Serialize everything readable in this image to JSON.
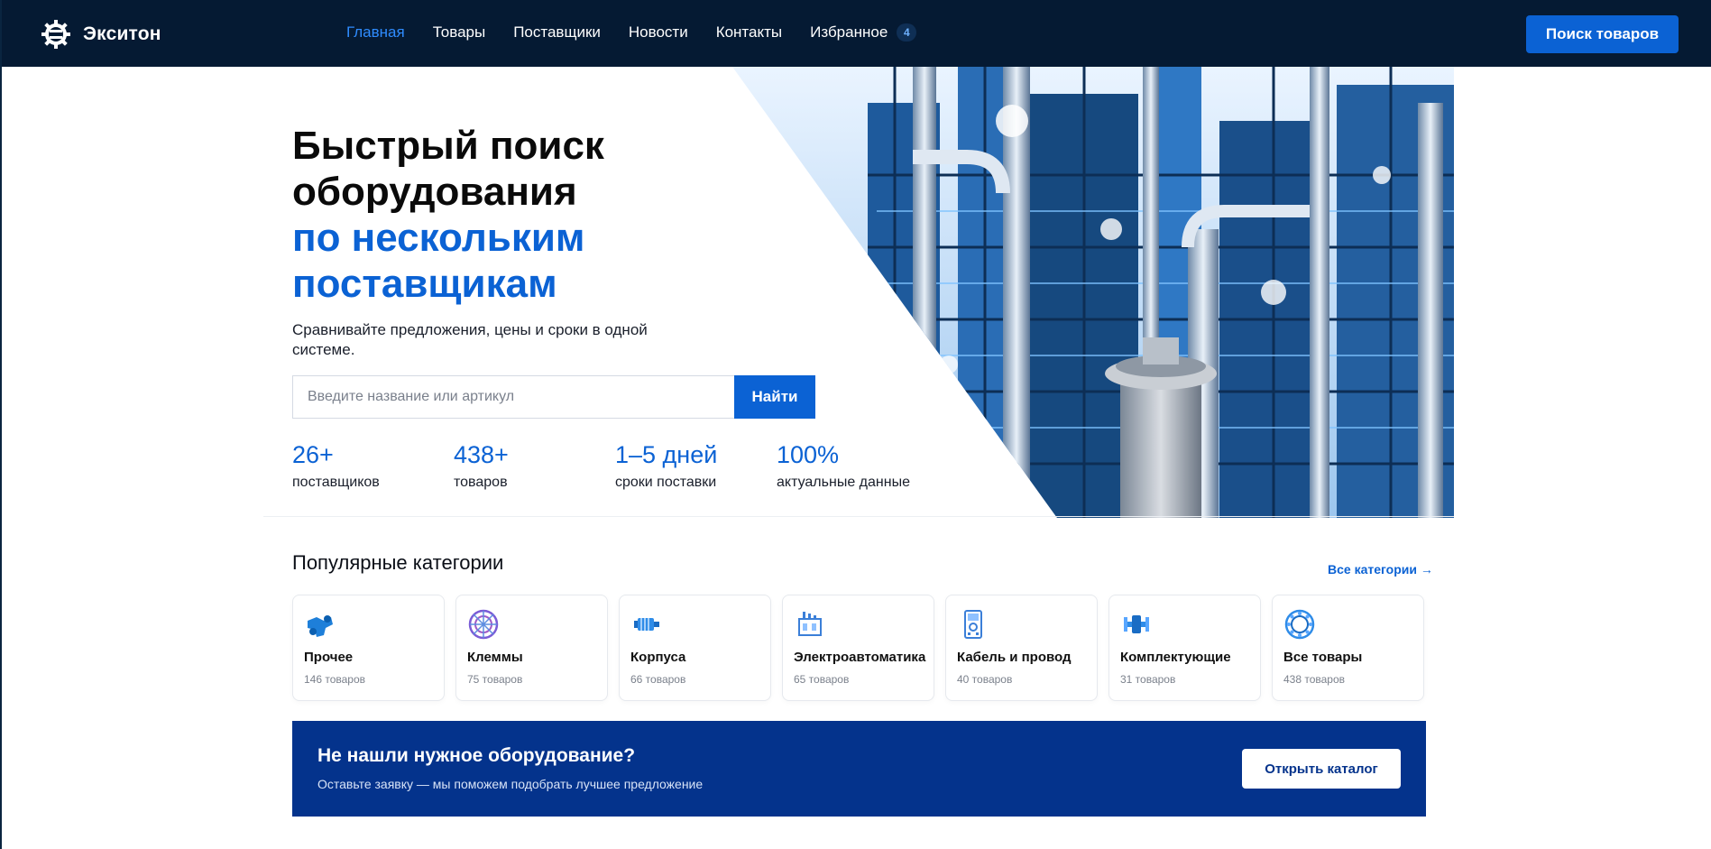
{
  "header": {
    "brand": "Экситон",
    "nav": [
      {
        "label": "Главная",
        "active": true
      },
      {
        "label": "Товары"
      },
      {
        "label": "Поставщики"
      },
      {
        "label": "Новости"
      },
      {
        "label": "Контакты"
      },
      {
        "label": "Избранное",
        "badge": "4"
      }
    ],
    "cta_label": "Поиск товаров"
  },
  "hero": {
    "title_lines": [
      "Быстрый поиск",
      "оборудования"
    ],
    "title_accent_lines": [
      "по нескольким",
      "поставщикам"
    ],
    "subtitle": "Сравнивайте предложения, цены и сроки в одной системе.",
    "search_placeholder": "Введите название или артикул",
    "search_button": "Найти",
    "stats": [
      {
        "value": "26+",
        "label": "поставщиков"
      },
      {
        "value": "438+",
        "label": "товаров"
      },
      {
        "value": "1–5 дней",
        "label": "сроки поставки"
      },
      {
        "value": "100%",
        "label": "актуальные данные"
      }
    ]
  },
  "categories": {
    "title": "Популярные категории",
    "all_link": "Все категории →",
    "items": [
      {
        "name": "Прочее",
        "count": "146 товаров",
        "icon": "pipe-fitting-icon"
      },
      {
        "name": "Клеммы",
        "count": "75 товаров",
        "icon": "terminal-block-icon"
      },
      {
        "name": "Корпуса",
        "count": "66 товаров",
        "icon": "motor-housing-icon"
      },
      {
        "name": "Электроавтоматика",
        "count": "65 товаров",
        "icon": "circuit-breaker-icon"
      },
      {
        "name": "Кабель и провод",
        "count": "40 товаров",
        "icon": "multimeter-icon"
      },
      {
        "name": "Комплектующие",
        "count": "31 товаров",
        "icon": "coupling-icon"
      },
      {
        "name": "Все товары",
        "count": "438 товаров",
        "icon": "gear-circle-icon"
      }
    ]
  },
  "cta": {
    "title": "Не нашли нужное оборудование?",
    "subtitle": "Оставьте заявку — мы поможем подобрать лучшее предложение",
    "button": "Открыть каталог"
  },
  "colors": {
    "header_bg": "#051a33",
    "accent": "#0b62d4",
    "cta_bg": "#04338c"
  }
}
